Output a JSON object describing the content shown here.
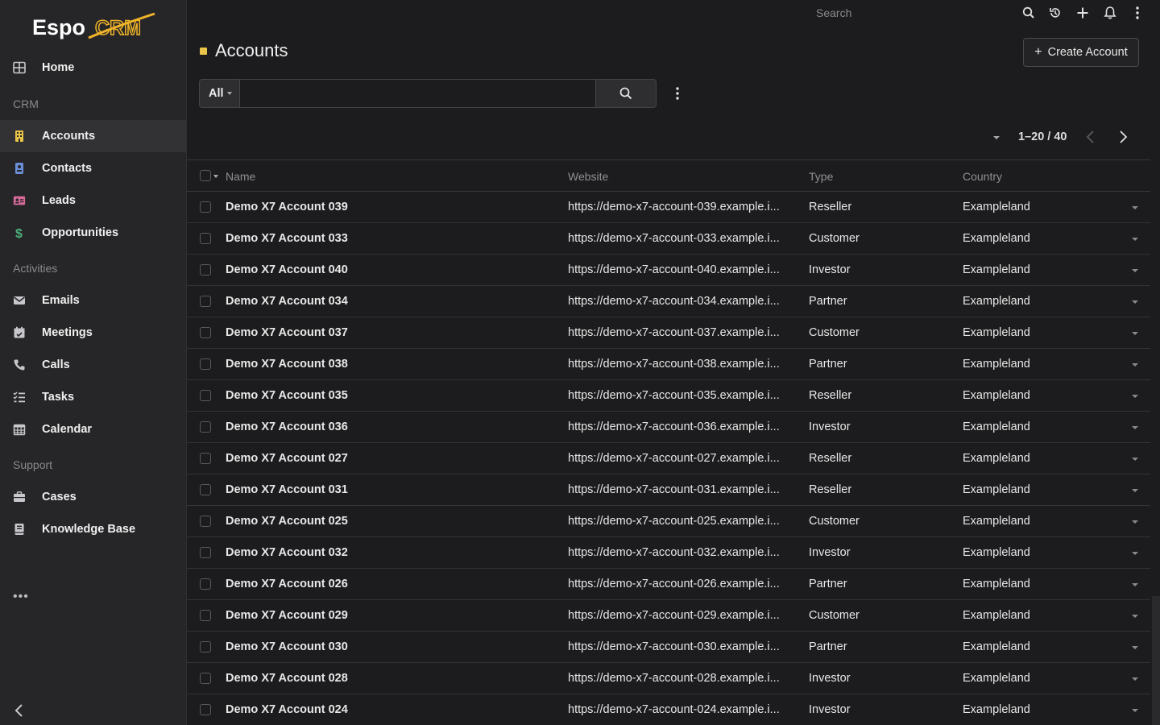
{
  "app": {
    "logo_text": "EspoCRM"
  },
  "sidebar": {
    "items": [
      {
        "label": "Home",
        "icon": "home-grid-icon"
      },
      {
        "group": "CRM"
      },
      {
        "label": "Accounts",
        "icon": "building-icon",
        "active": true
      },
      {
        "label": "Contacts",
        "icon": "id-badge-icon"
      },
      {
        "label": "Leads",
        "icon": "address-card-icon"
      },
      {
        "label": "Opportunities",
        "icon": "dollar-icon"
      },
      {
        "group": "Activities"
      },
      {
        "label": "Emails",
        "icon": "envelope-icon"
      },
      {
        "label": "Meetings",
        "icon": "calendar-check-icon"
      },
      {
        "label": "Calls",
        "icon": "phone-icon"
      },
      {
        "label": "Tasks",
        "icon": "tasks-list-icon"
      },
      {
        "label": "Calendar",
        "icon": "calendar-grid-icon"
      },
      {
        "group": "Support"
      },
      {
        "label": "Cases",
        "icon": "briefcase-icon"
      },
      {
        "label": "Knowledge Base",
        "icon": "book-icon"
      }
    ],
    "more_label": "•••"
  },
  "topbar": {
    "search_placeholder": "Search"
  },
  "header": {
    "title": "Accounts",
    "create_label": "Create Account"
  },
  "filter": {
    "all_label": "All",
    "search_value": ""
  },
  "pagination": {
    "text": "1–20 / 40"
  },
  "table": {
    "columns": [
      "Name",
      "Website",
      "Type",
      "Country"
    ],
    "rows": [
      {
        "name": "Demo X7 Account 039",
        "website": "https://demo-x7-account-039.example.i...",
        "type": "Reseller",
        "country": "Exampleland"
      },
      {
        "name": "Demo X7 Account 033",
        "website": "https://demo-x7-account-033.example.i...",
        "type": "Customer",
        "country": "Exampleland"
      },
      {
        "name": "Demo X7 Account 040",
        "website": "https://demo-x7-account-040.example.i...",
        "type": "Investor",
        "country": "Exampleland"
      },
      {
        "name": "Demo X7 Account 034",
        "website": "https://demo-x7-account-034.example.i...",
        "type": "Partner",
        "country": "Exampleland"
      },
      {
        "name": "Demo X7 Account 037",
        "website": "https://demo-x7-account-037.example.i...",
        "type": "Customer",
        "country": "Exampleland"
      },
      {
        "name": "Demo X7 Account 038",
        "website": "https://demo-x7-account-038.example.i...",
        "type": "Partner",
        "country": "Exampleland"
      },
      {
        "name": "Demo X7 Account 035",
        "website": "https://demo-x7-account-035.example.i...",
        "type": "Reseller",
        "country": "Exampleland"
      },
      {
        "name": "Demo X7 Account 036",
        "website": "https://demo-x7-account-036.example.i...",
        "type": "Investor",
        "country": "Exampleland"
      },
      {
        "name": "Demo X7 Account 027",
        "website": "https://demo-x7-account-027.example.i...",
        "type": "Reseller",
        "country": "Exampleland"
      },
      {
        "name": "Demo X7 Account 031",
        "website": "https://demo-x7-account-031.example.i...",
        "type": "Reseller",
        "country": "Exampleland"
      },
      {
        "name": "Demo X7 Account 025",
        "website": "https://demo-x7-account-025.example.i...",
        "type": "Customer",
        "country": "Exampleland"
      },
      {
        "name": "Demo X7 Account 032",
        "website": "https://demo-x7-account-032.example.i...",
        "type": "Investor",
        "country": "Exampleland"
      },
      {
        "name": "Demo X7 Account 026",
        "website": "https://demo-x7-account-026.example.i...",
        "type": "Partner",
        "country": "Exampleland"
      },
      {
        "name": "Demo X7 Account 029",
        "website": "https://demo-x7-account-029.example.i...",
        "type": "Customer",
        "country": "Exampleland"
      },
      {
        "name": "Demo X7 Account 030",
        "website": "https://demo-x7-account-030.example.i...",
        "type": "Partner",
        "country": "Exampleland"
      },
      {
        "name": "Demo X7 Account 028",
        "website": "https://demo-x7-account-028.example.i...",
        "type": "Investor",
        "country": "Exampleland"
      },
      {
        "name": "Demo X7 Account 024",
        "website": "https://demo-x7-account-024.example.i...",
        "type": "Investor",
        "country": "Exampleland"
      }
    ]
  },
  "colors": {
    "accent": "#e8c44a",
    "background": "#1c1c1e",
    "sidebar": "#262628"
  }
}
